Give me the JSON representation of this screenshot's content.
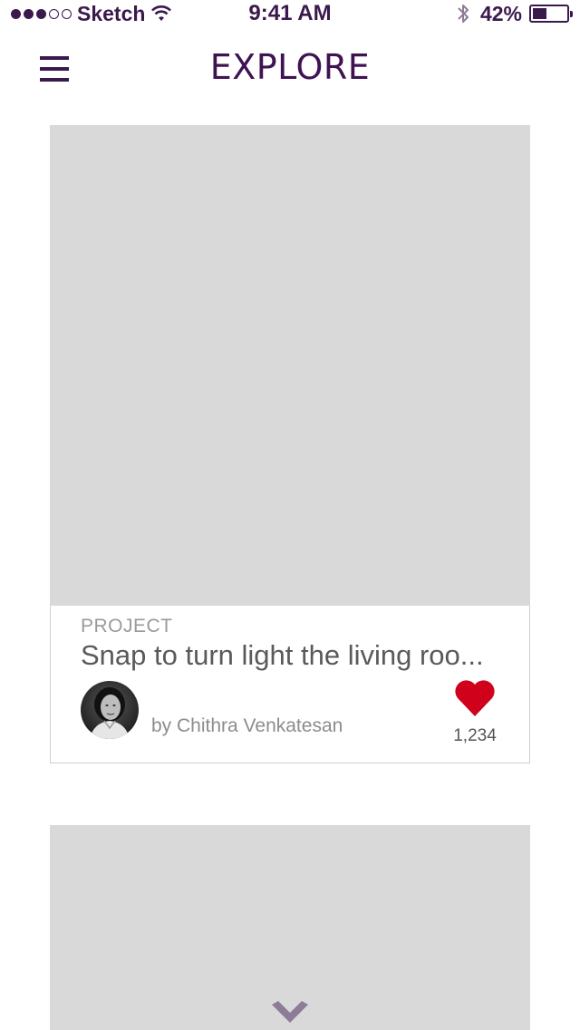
{
  "status_bar": {
    "carrier": "Sketch",
    "time": "9:41 AM",
    "battery_percent_label": "42%",
    "battery_level": 0.42,
    "signal_bars_filled": 3,
    "signal_bars_total": 5
  },
  "nav": {
    "title": "EXPLORE",
    "menu_icon": "hamburger-menu-icon"
  },
  "cards": [
    {
      "category": "PROJECT",
      "title": "Snap to turn light the living roo...",
      "author": "by Chithra Venkatesan",
      "likes": "1,234",
      "like_icon": "heart-icon"
    }
  ],
  "colors": {
    "brand": "#3f1352",
    "like": "#d0021b",
    "image_placeholder": "#d9d9d9",
    "chevron": "#8e7b96"
  },
  "scroll_icon": "chevron-down-icon"
}
